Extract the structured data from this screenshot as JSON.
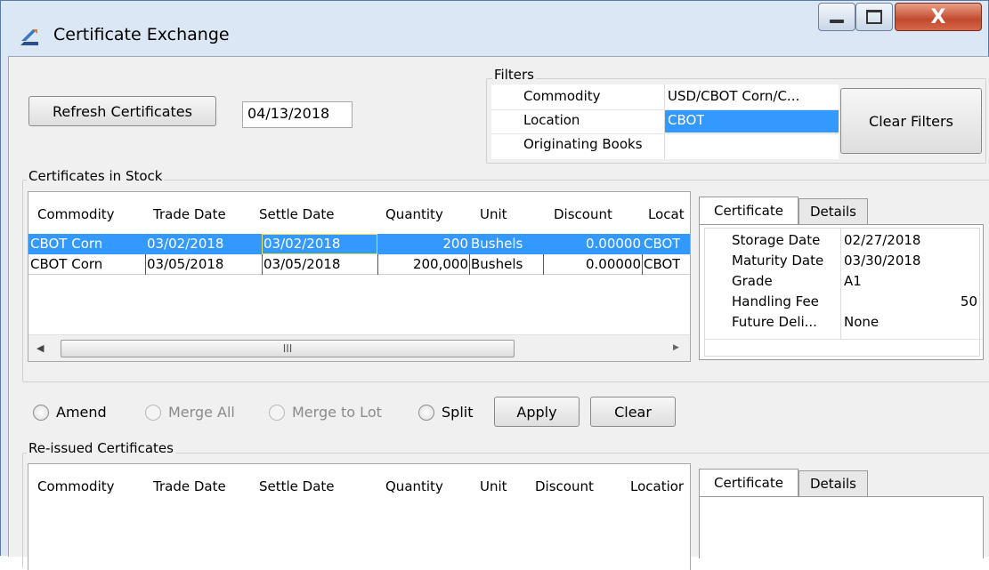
{
  "window": {
    "title": "Certificate Exchange",
    "close_glyph": "X"
  },
  "toolbar": {
    "refresh_label": "Refresh Certificates",
    "date_value": "04/13/2018"
  },
  "filters": {
    "legend": "Filters",
    "rows": [
      {
        "label": "Commodity",
        "value": "USD/CBOT Corn/C..."
      },
      {
        "label": "Location",
        "value": "CBOT"
      },
      {
        "label": "Originating Books",
        "value": ""
      }
    ],
    "clear_label": "Clear Filters"
  },
  "stock": {
    "legend": "Certificates in Stock",
    "columns": [
      "Commodity",
      "Trade Date",
      "Settle Date",
      "Quantity",
      "Unit",
      "Discount",
      "Locat"
    ],
    "rows": [
      [
        "CBOT Corn",
        "03/02/2018",
        "03/02/2018",
        "200",
        "Bushels",
        "0.00000",
        "CBOT"
      ],
      [
        "CBOT Corn",
        "03/05/2018",
        "03/05/2018",
        "200,000",
        "Bushels",
        "0.00000",
        "CBOT"
      ]
    ],
    "scroll_thumb_glyph": "III",
    "details_tabs": [
      "Certificate",
      "Details"
    ],
    "details": [
      {
        "label": "Storage Date",
        "value": "02/27/2018"
      },
      {
        "label": "Maturity Date",
        "value": "03/30/2018"
      },
      {
        "label": "Grade",
        "value": "A1"
      },
      {
        "label": "Handling Fee",
        "value": "50"
      },
      {
        "label": "Future Deli...",
        "value": "None"
      }
    ]
  },
  "actions": {
    "radios": [
      {
        "label": "Amend",
        "enabled": true
      },
      {
        "label": "Merge All",
        "enabled": false
      },
      {
        "label": "Merge to Lot",
        "enabled": false
      },
      {
        "label": "Split",
        "enabled": true
      }
    ],
    "apply_label": "Apply",
    "clear_label": "Clear"
  },
  "reissued": {
    "legend": "Re-issued Certificates",
    "columns": [
      "Commodity",
      "Trade Date",
      "Settle Date",
      "Quantity",
      "Unit",
      "Discount",
      "Locatior"
    ],
    "details_tabs": [
      "Certificate",
      "Details"
    ]
  },
  "colors": {
    "selection": "#3399ff",
    "window_frame": "#dbe7f4",
    "client_bg": "#f0f0f0"
  }
}
